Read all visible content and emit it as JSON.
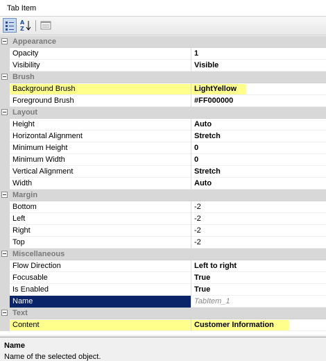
{
  "window": {
    "title": "Tab Item"
  },
  "toolbar": {
    "categorized_icon": "categorized-icon",
    "alphabetical_icon": "alphabetical-icon",
    "property_pages_icon": "property-pages-icon"
  },
  "grid": {
    "categories": [
      {
        "label": "Appearance",
        "rows": [
          {
            "name": "Opacity",
            "value": "1"
          },
          {
            "name": "Visibility",
            "value": "Visible"
          }
        ]
      },
      {
        "label": "Brush",
        "rows": [
          {
            "name": "Background Brush",
            "value": "LightYellow"
          },
          {
            "name": "Foreground Brush",
            "value": "#FF000000"
          }
        ]
      },
      {
        "label": "Layout",
        "rows": [
          {
            "name": "Height",
            "value": "Auto"
          },
          {
            "name": "Horizontal Alignment",
            "value": "Stretch"
          },
          {
            "name": "Minimum Height",
            "value": "0"
          },
          {
            "name": "Minimum Width",
            "value": "0"
          },
          {
            "name": "Vertical Alignment",
            "value": "Stretch"
          },
          {
            "name": "Width",
            "value": "Auto"
          }
        ]
      },
      {
        "label": "Margin",
        "rows": [
          {
            "name": "Bottom",
            "value": "-2"
          },
          {
            "name": "Left",
            "value": "-2"
          },
          {
            "name": "Right",
            "value": "-2"
          },
          {
            "name": "Top",
            "value": "-2"
          }
        ]
      },
      {
        "label": "Miscellaneous",
        "rows": [
          {
            "name": "Flow Direction",
            "value": "Left to right"
          },
          {
            "name": "Focusable",
            "value": "True"
          },
          {
            "name": "Is Enabled",
            "value": "True"
          },
          {
            "name": "Name",
            "value": "TabItem_1"
          }
        ]
      },
      {
        "label": "Text",
        "rows": [
          {
            "name": "Content",
            "value": "Customer Information"
          }
        ]
      }
    ]
  },
  "description": {
    "title": "Name",
    "text": "Name of the selected object."
  },
  "colors": {
    "highlight": "#ffff8c",
    "selection": "#0a246a",
    "category_bg": "#d8d8d8"
  }
}
